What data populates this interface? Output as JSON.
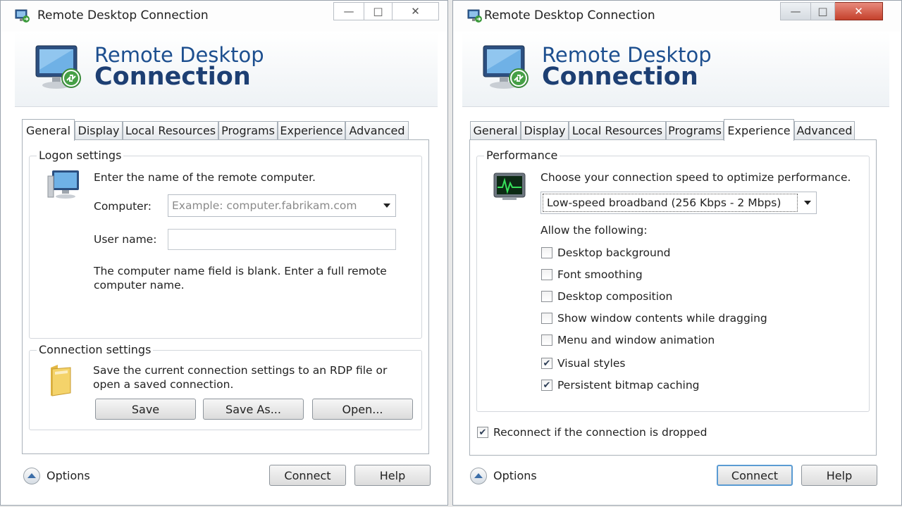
{
  "left": {
    "window_title": "Remote Desktop Connection",
    "brand_line1": "Remote Desktop",
    "brand_line2": "Connection",
    "tabs": [
      "General",
      "Display",
      "Local Resources",
      "Programs",
      "Experience",
      "Advanced"
    ],
    "active_tab": "General",
    "logon": {
      "group_label": "Logon settings",
      "intro": "Enter the name of the remote computer.",
      "computer_label": "Computer:",
      "computer_placeholder": "Example: computer.fabrikam.com",
      "username_label": "User name:",
      "username_value": "",
      "hint": "The computer name field is blank. Enter a full remote computer name."
    },
    "connection": {
      "group_label": "Connection settings",
      "text": "Save the current connection settings to an RDP file or open a saved connection.",
      "save": "Save",
      "save_as": "Save As...",
      "open": "Open..."
    },
    "options": "Options",
    "connect": "Connect",
    "help": "Help"
  },
  "right": {
    "window_title": "Remote Desktop Connection",
    "brand_line1": "Remote Desktop",
    "brand_line2": "Connection",
    "tabs": [
      "General",
      "Display",
      "Local Resources",
      "Programs",
      "Experience",
      "Advanced"
    ],
    "active_tab": "Experience",
    "performance": {
      "group_label": "Performance",
      "intro": "Choose your connection speed to optimize performance.",
      "speed_selected": "Low-speed broadband (256 Kbps - 2 Mbps)",
      "allow_label": "Allow the following:",
      "checkboxes": [
        {
          "label": "Desktop background",
          "checked": false
        },
        {
          "label": "Font smoothing",
          "checked": false
        },
        {
          "label": "Desktop composition",
          "checked": false
        },
        {
          "label": "Show window contents while dragging",
          "checked": false
        },
        {
          "label": "Menu and window animation",
          "checked": false
        },
        {
          "label": "Visual styles",
          "checked": true
        },
        {
          "label": "Persistent bitmap caching",
          "checked": true
        }
      ]
    },
    "reconnect": {
      "label": "Reconnect if the connection is dropped",
      "checked": true
    },
    "options": "Options",
    "connect": "Connect",
    "help": "Help"
  },
  "colors": {
    "brand_blue": "#1d4f8f",
    "default_button_border": "#5a9bd3",
    "close_button": "#c4402b"
  },
  "icons": {
    "title": "remote-desktop-icon",
    "header": "monitor-with-connection-icon",
    "logon": "computer-icon",
    "connection": "folder-icon",
    "performance": "performance-monitor-icon",
    "options": "chevron-up-icon",
    "minimize": "minimize-icon",
    "maximize": "maximize-icon",
    "close": "close-icon"
  }
}
